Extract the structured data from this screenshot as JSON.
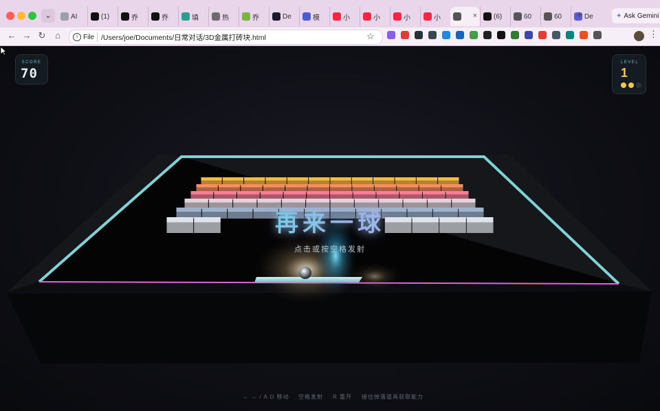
{
  "browser": {
    "tab_dropdown_icon": "chevron-down-icon",
    "tabs": [
      {
        "label": "AI",
        "favicon": "doc-icon",
        "color": "#9aa0a6"
      },
      {
        "label": "(1)",
        "favicon": "x-icon",
        "color": "#111111"
      },
      {
        "label": "乔",
        "favicon": "openai-icon",
        "color": "#111111"
      },
      {
        "label": "乔",
        "favicon": "openai-icon",
        "color": "#111111"
      },
      {
        "label": "填",
        "favicon": "bird-icon",
        "color": "#2a9d8f"
      },
      {
        "label": "热",
        "favicon": "globe-icon",
        "color": "#6b6b6b"
      },
      {
        "label": "乔",
        "favicon": "app-icon",
        "color": "#7cb342"
      },
      {
        "label": "De",
        "favicon": "deepseek-icon",
        "color": "#1a1a2e"
      },
      {
        "label": "模",
        "favicon": "deepseek-icon",
        "color": "#4a5bd4"
      },
      {
        "label": "小",
        "favicon": "redbook-icon",
        "color": "#ff2442"
      },
      {
        "label": "小",
        "favicon": "redbook-icon",
        "color": "#ff2442"
      },
      {
        "label": "小",
        "favicon": "redbook-icon",
        "color": "#ff2442"
      },
      {
        "label": "小",
        "favicon": "redbook-icon",
        "color": "#ff2442"
      },
      {
        "label": "",
        "favicon": "globe-icon",
        "color": "#555555",
        "active": true
      },
      {
        "label": "(6)",
        "favicon": "x-icon",
        "color": "#111111"
      },
      {
        "label": "60",
        "favicon": "globe-icon",
        "color": "#555555"
      },
      {
        "label": "60",
        "favicon": "globe-icon",
        "color": "#555555"
      },
      {
        "label": "De",
        "favicon": "doc-icon",
        "color": "#5b5bd6"
      }
    ],
    "new_tab_label": "+",
    "gemini_label": "Ask Gemini",
    "file_chip": "File",
    "url": "/Users/joe/Documents/日常对话/3D金属打砖块.html",
    "extensions": [
      {
        "name": "puzzle-purple-icon",
        "color": "#8a5cf6"
      },
      {
        "name": "red-circle-icon",
        "color": "#e53935"
      },
      {
        "name": "arrow-dark-icon",
        "color": "#263238"
      },
      {
        "name": "camera-icon",
        "color": "#37474f"
      },
      {
        "name": "scissors-icon",
        "color": "#1e88e5"
      },
      {
        "name": "new-badge-icon",
        "color": "#1565c0"
      },
      {
        "name": "green-round-icon",
        "color": "#43a047"
      },
      {
        "name": "circle-dark-icon",
        "color": "#212121"
      },
      {
        "name": "openai-ext-icon",
        "color": "#111111"
      },
      {
        "name": "triangle-green-icon",
        "color": "#2e7d32"
      },
      {
        "name": "shield-blue-icon",
        "color": "#3949ab"
      },
      {
        "name": "red-square-icon",
        "color": "#e53935"
      },
      {
        "name": "bookmark-icon",
        "color": "#455a64"
      },
      {
        "name": "m-teal-icon",
        "color": "#00897b"
      },
      {
        "name": "figma-icon",
        "color": "#f24e1e"
      },
      {
        "name": "extensions-icon",
        "color": "#555555"
      }
    ]
  },
  "game": {
    "score_label": "SCORE",
    "score": "70",
    "level_label": "LEVEL",
    "level": "1",
    "lives_total": 3,
    "lives_remaining": 2,
    "life_color": "#f4c84e",
    "life_empty_color": "#2c3238",
    "overlay_title": "再来一球",
    "overlay_subtitle": "点击或按空格发射",
    "hints": [
      "← → / A D 移动",
      "空格发射",
      "R 重开",
      "接住掉落道具获取能力"
    ],
    "brick_rows": [
      {
        "color": "#e7a93a",
        "present": [
          1,
          1,
          1,
          1,
          1,
          1,
          1,
          1,
          1,
          1,
          1,
          1
        ]
      },
      {
        "color": "#df7e57",
        "present": [
          1,
          1,
          1,
          1,
          1,
          1,
          1,
          1,
          1,
          1,
          1,
          1
        ]
      },
      {
        "color": "#de6f88",
        "present": [
          1,
          1,
          1,
          1,
          1,
          1,
          1,
          1,
          1,
          1,
          1,
          1
        ]
      },
      {
        "color": "#c9bdc4",
        "present": [
          1,
          1,
          1,
          1,
          1,
          1,
          1,
          1,
          1,
          1,
          1,
          1
        ]
      },
      {
        "color": "#8d9fb8",
        "present": [
          1,
          1,
          1,
          1,
          1,
          1,
          1,
          1,
          1,
          1,
          1,
          1
        ]
      },
      {
        "color": "#c7ccd2",
        "present": [
          1,
          1,
          0,
          0,
          0,
          0,
          0,
          0,
          1,
          1,
          1,
          1
        ]
      }
    ],
    "frame_color": "#7fd3d6",
    "bottom_edge_color": "#e163d8",
    "paddle_color": "#9fd6dc",
    "ball_color": "#c9cdd2"
  }
}
